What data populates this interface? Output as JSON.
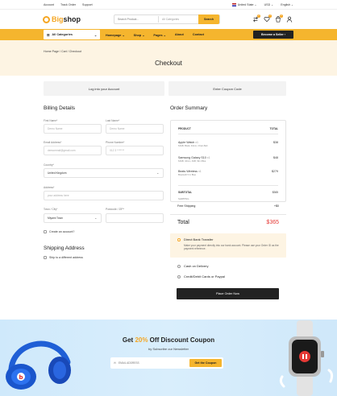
{
  "topbar": {
    "links": [
      "Account",
      "Track Order",
      "Support"
    ],
    "country": "United State",
    "currency": "USD",
    "language": "English"
  },
  "header": {
    "logo_accent": "Big",
    "logo_rest": "shop",
    "search_placeholder": "Search Product...",
    "category_select": "All Categories",
    "search_button": "Search",
    "wishlist_count": "2",
    "cart_count": "2"
  },
  "nav": {
    "all_categories": "All Categories",
    "links": [
      "Homepage",
      "Shop",
      "Pages",
      "About",
      "Contact"
    ],
    "seller_button": "Become a Seller"
  },
  "hero": {
    "breadcrumb": "Home Page / Cart / Checkout",
    "title": "Checkout"
  },
  "actions": {
    "login": "Log into your Account",
    "coupon": "Enter Coupon Code"
  },
  "billing": {
    "title": "Billing Details",
    "first_name_label": "First Name*",
    "first_name_ph": "Demo Name",
    "last_name_label": "Last Name*",
    "last_name_ph": "Demo Name",
    "email_label": "Email Address*",
    "email_ph": "demoemail@gmail.com",
    "phone_label": "Phone Number*",
    "phone_ph": "012 3  *******",
    "country_label": "Country*",
    "country_value": "United Kingdom",
    "address_label": "Address*",
    "address_ph": "your address here",
    "town_label": "Town / City*",
    "town_value": "Miyami Town",
    "postcode_label": "Postcode / ZIP*",
    "create_account": "Create an account?"
  },
  "shipping": {
    "title": "Shipping Address",
    "different": "Ship to a different address"
  },
  "summary": {
    "title": "Order Summary",
    "col_product": "PRODUCT",
    "col_total": "TOTAL",
    "items": [
      {
        "name": "Apple Watch",
        "qty": "x1",
        "variant": "64GB, Black, 44mm, Chain Belt",
        "price": "$38"
      },
      {
        "name": "Samsung Galaxy S10",
        "qty": "x1",
        "variant": "64GB, 44mm, 4GB, Slim Blue",
        "price": "$48"
      },
      {
        "name": "Beats Wireless",
        "qty": "x1",
        "variant": "Bluetooth 5.0, Blue",
        "price": "$279"
      }
    ],
    "subtotal_label": "SUBTOTAL",
    "subtotal_value": "$365",
    "shipping_label": "SHIPPING",
    "free_shipping": "Free Shipping",
    "free_value": "+$0",
    "total_label": "Total",
    "total_value": "$365"
  },
  "payment": {
    "direct_title": "Direct Bank Transfer",
    "direct_desc": "Make your payment directly into our bank account. Please use your Order ID as the payment reference.",
    "cod": "Cash on Delivery",
    "card": "Credit/Debit Cards or Paypal",
    "place_order": "Place Order Now"
  },
  "coupon": {
    "pre": "Get ",
    "accent": "20%",
    "post": " Off Discount Coupon",
    "subtitle": "by Subscribe our Newsletter",
    "email_ph": "EMAIL ADDRESS",
    "button": "Get the Coupon"
  },
  "colors": {
    "accent": "#f5b52e",
    "hero_bg": "#fdf4e3",
    "total_red": "#e53935",
    "footer_bg": "#d4ebfb"
  }
}
